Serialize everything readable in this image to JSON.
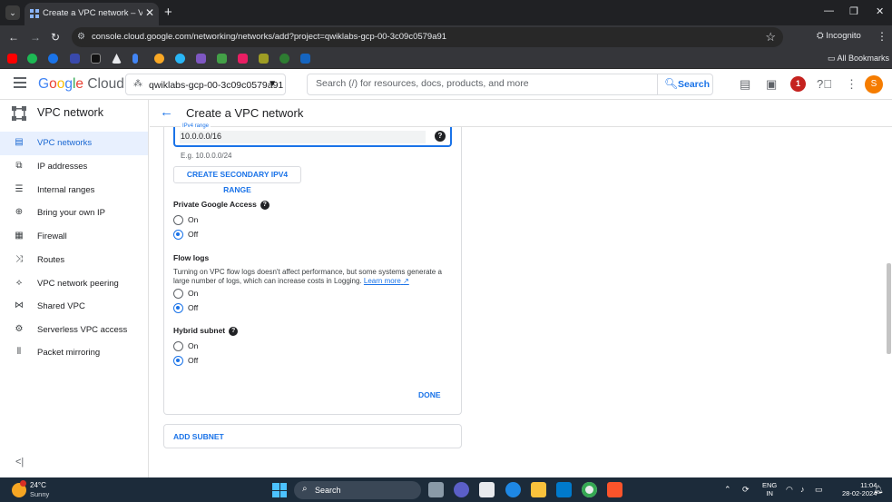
{
  "browser": {
    "tab_title": "Create a VPC network – VPC ne",
    "url": "console.cloud.google.com/networking/networks/add?project=qwiklabs-gcp-00-3c09c0579a91",
    "incognito_label": "Incognito",
    "all_bookmarks_label": "All Bookmarks"
  },
  "header": {
    "logo_g": "G",
    "logo_o1": "o",
    "logo_o2": "o",
    "logo_g2": "g",
    "logo_l": "l",
    "logo_e": "e",
    "logo_cloud": "Cloud",
    "project_name": "qwiklabs-gcp-00-3c09c0579a91",
    "search_placeholder": "Search (/) for resources, docs, products, and more",
    "search_button": "Search",
    "notification_count": "1",
    "avatar_letter": "S"
  },
  "sidebar": {
    "product_title": "VPC network",
    "items": [
      {
        "label": "VPC networks",
        "icon": "vpc-networks-icon"
      },
      {
        "label": "IP addresses",
        "icon": "ip-addresses-icon"
      },
      {
        "label": "Internal ranges",
        "icon": "internal-ranges-icon"
      },
      {
        "label": "Bring your own IP",
        "icon": "byoip-icon"
      },
      {
        "label": "Firewall",
        "icon": "firewall-icon"
      },
      {
        "label": "Routes",
        "icon": "routes-icon"
      },
      {
        "label": "VPC network peering",
        "icon": "peering-icon"
      },
      {
        "label": "Shared VPC",
        "icon": "shared-vpc-icon"
      },
      {
        "label": "Serverless VPC access",
        "icon": "serverless-icon"
      },
      {
        "label": "Packet mirroring",
        "icon": "packet-mirroring-icon"
      }
    ],
    "active_index": 0
  },
  "page": {
    "title": "Create a VPC network"
  },
  "form": {
    "ipv4_range_label": "IPv4 range",
    "ipv4_range_value": "10.0.0.0/16",
    "ipv4_hint": "E.g. 10.0.0.0/24",
    "create_secondary_button": "CREATE SECONDARY IPV4 RANGE",
    "private_google_access": {
      "label": "Private Google Access",
      "options": [
        "On",
        "Off"
      ],
      "selected": "Off"
    },
    "flow_logs": {
      "label": "Flow logs",
      "description": "Turning on VPC flow logs doesn't affect performance, but some systems generate a large number of logs, which can increase costs in Logging.",
      "learn_more": "Learn more",
      "options": [
        "On",
        "Off"
      ],
      "selected": "Off"
    },
    "hybrid_subnet": {
      "label": "Hybrid subnet",
      "options": [
        "On",
        "Off"
      ],
      "selected": "Off"
    },
    "done_button": "DONE",
    "add_subnet_button": "ADD SUBNET"
  },
  "taskbar": {
    "temperature": "24°C",
    "weather": "Sunny",
    "search_label": "Search",
    "lang_line1": "ENG",
    "lang_line2": "IN",
    "time": "11:04",
    "date": "28-02-2024"
  },
  "colors": {
    "accent": "#1a73e8",
    "active_nav_bg": "#e8f0fe",
    "notification": "#c5221f",
    "avatar": "#f57c00"
  }
}
